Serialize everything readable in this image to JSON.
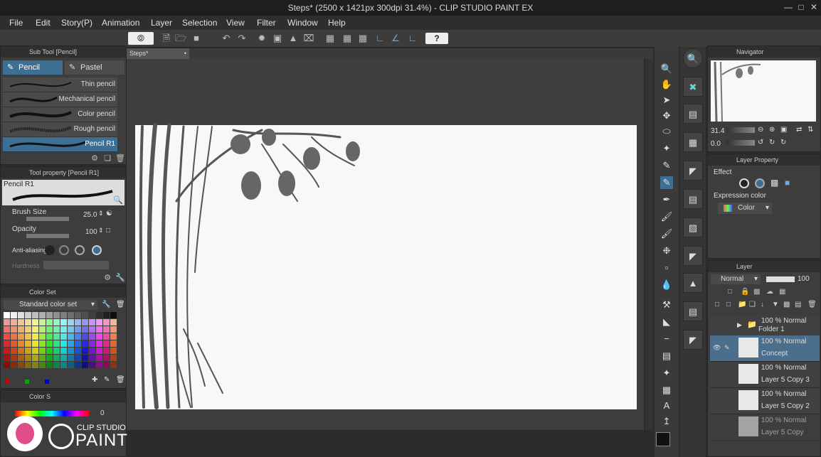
{
  "window": {
    "title": "Steps* (2500 x 1421px 300dpi 31.4%) - CLIP STUDIO PAINT EX"
  },
  "menu": [
    "File",
    "Edit",
    "Story(P)",
    "Animation",
    "Layer",
    "Selection",
    "View",
    "Filter",
    "Window",
    "Help"
  ],
  "canvas_tab": {
    "label": "Steps*"
  },
  "subtool": {
    "header": "Sub Tool [Pencil]",
    "tabs": [
      "Pencil",
      "Pastel"
    ],
    "brushes": [
      "Thin pencil",
      "Mechanical pencil",
      "Color pencil",
      "Rough pencil",
      "Pencil R1"
    ]
  },
  "tool_property": {
    "header": "Tool property [Pencil R1]",
    "preset_name": "Pencil R1",
    "brush_size_label": "Brush Size",
    "brush_size_value": "25.0",
    "opacity_label": "Opacity",
    "opacity_value": "100",
    "antialias_label": "Anti-aliasing",
    "hardness_label": "Hardness"
  },
  "color_set": {
    "header": "Color Set",
    "selected_set": "Standard color set"
  },
  "color_slider": {
    "header": "Color S",
    "value": "0"
  },
  "navigator": {
    "header": "Navigator",
    "zoom": "31.4",
    "rotation": "0.0"
  },
  "layer_property": {
    "header": "Layer Property",
    "effect_label": "Effect",
    "expression_label": "Expression color",
    "expression_value": "Color"
  },
  "layer_panel": {
    "header": "Layer",
    "blend_mode": "Normal",
    "opacity": "100",
    "layers": [
      {
        "top": "100 % Normal",
        "name": "Folder 1"
      },
      {
        "top": "100 % Normal",
        "name": "Concept"
      },
      {
        "top": "100 % Normal",
        "name": "Layer 5 Copy 3"
      },
      {
        "top": "100 % Normal",
        "name": "Layer 5 Copy 2"
      },
      {
        "top": "100 % Normal",
        "name": "Layer 5 Copy"
      }
    ]
  },
  "logo": {
    "line1": "CLIP STUDIO",
    "line2": "PAINT"
  },
  "colors": {
    "accent": "#3d6f95",
    "paper": "#f8f8f6"
  }
}
